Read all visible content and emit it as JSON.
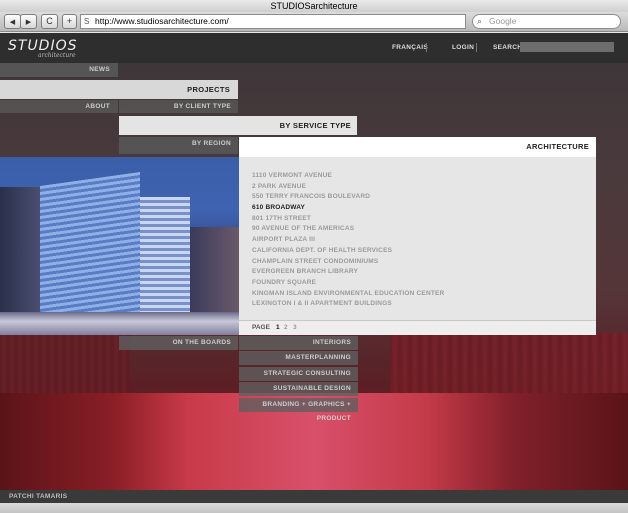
{
  "browser": {
    "window_title": "STUDIOSarchitecture",
    "url": "http://www.studiosarchitecture.com/",
    "search_placeholder": "Google",
    "back_icon": "◀",
    "forward_icon": "▶",
    "reload_icon": "C",
    "add_icon": "+"
  },
  "header": {
    "logo": "STUDIOS",
    "logo_sub": "architecture",
    "links": {
      "francais": "FRANÇAIS",
      "login": "LOGIN",
      "search": "SEARCH"
    }
  },
  "nav": {
    "news": "NEWS",
    "projects": "PROJECTS",
    "about": "ABOUT",
    "by_client_type": "BY CLIENT TYPE",
    "by_service_type": "BY SERVICE TYPE",
    "by_region": "BY REGION",
    "on_the_boards": "ON THE BOARDS"
  },
  "services": {
    "selected": "ARCHITECTURE",
    "others": [
      "INTERIORS",
      "MASTERPLANNING",
      "STRATEGIC CONSULTING",
      "SUSTAINABLE DESIGN",
      "BRANDING + GRAPHICS + PRODUCT"
    ]
  },
  "projects": [
    {
      "name": "1110 VERMONT AVENUE",
      "selected": false
    },
    {
      "name": "2 PARK AVENUE",
      "selected": false
    },
    {
      "name": "550 TERRY FRANCOIS BOULEVARD",
      "selected": false
    },
    {
      "name": "610 BROADWAY",
      "selected": true
    },
    {
      "name": "801 17TH STREET",
      "selected": false
    },
    {
      "name": "90 AVENUE OF THE AMERICAS",
      "selected": false
    },
    {
      "name": "AIRPORT PLAZA III",
      "selected": false
    },
    {
      "name": "CALIFORNIA DEPT. OF HEALTH SERVICES",
      "selected": false
    },
    {
      "name": "CHAMPLAIN STREET CONDOMINIUMS",
      "selected": false
    },
    {
      "name": "EVERGREEN BRANCH LIBRARY",
      "selected": false
    },
    {
      "name": "FOUNDRY SQUARE",
      "selected": false
    },
    {
      "name": "KINGMAN ISLAND ENVIRONMENTAL EDUCATION CENTER",
      "selected": false
    },
    {
      "name": "LEXINGTON I & II APARTMENT BUILDINGS",
      "selected": false
    }
  ],
  "pager": {
    "label": "PAGE",
    "pages": [
      "1",
      "2",
      "3"
    ],
    "current": "1"
  },
  "footer": {
    "credit": "PATCHI TAMARIS"
  }
}
